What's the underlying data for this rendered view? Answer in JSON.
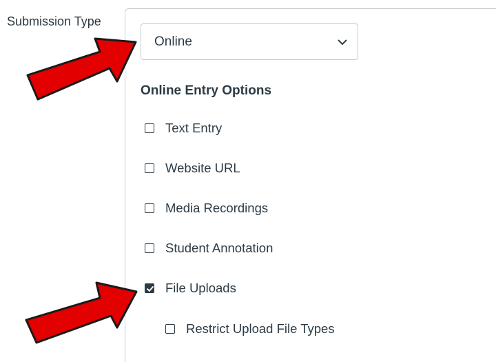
{
  "field_label": "Submission Type",
  "submission_type_select": {
    "selected": "Online",
    "icon": "chevron-down-icon"
  },
  "online_entry": {
    "title": "Online Entry Options",
    "options": [
      {
        "label": "Text Entry",
        "checked": false
      },
      {
        "label": "Website URL",
        "checked": false
      },
      {
        "label": "Media Recordings",
        "checked": false
      },
      {
        "label": "Student Annotation",
        "checked": false
      },
      {
        "label": "File Uploads",
        "checked": true
      }
    ],
    "sub_options": [
      {
        "label": "Restrict Upload File Types",
        "checked": false
      }
    ]
  },
  "annotations": {
    "arrow_color": "#e30000",
    "arrow_outline": "#1a1a1a"
  }
}
